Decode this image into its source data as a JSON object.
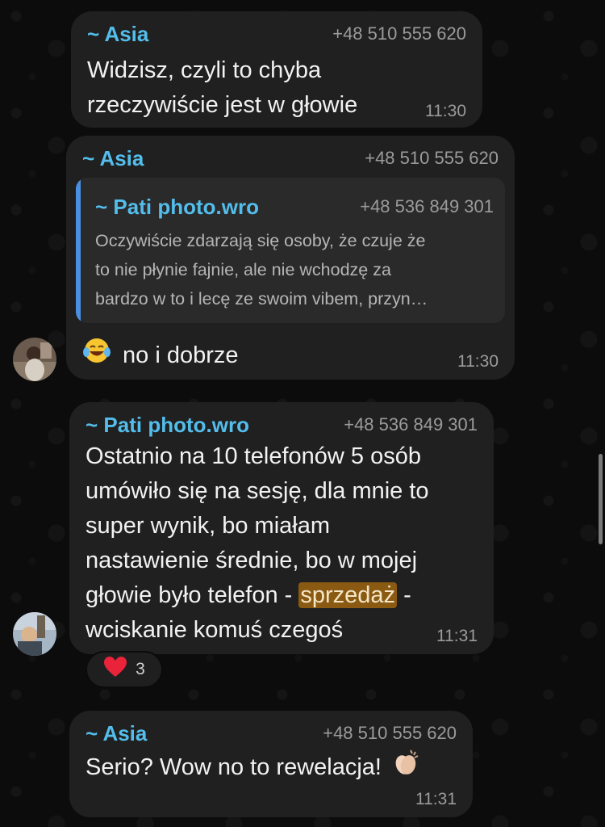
{
  "messages": [
    {
      "sender": "~ Asia",
      "phone": "+48 510 555 620",
      "lines": [
        "Widzisz, czyli to chyba",
        "rzeczywiście jest w głowie"
      ],
      "time": "11:30"
    },
    {
      "sender": "~ Asia",
      "phone": "+48 510 555 620",
      "quote": {
        "sender": "~ Pati photo.wro",
        "phone": "+48 536 849 301",
        "lines": [
          "Oczywiście zdarzają się osoby, że czuje że",
          "to nie płynie fajnie, ale nie wchodzę za",
          "bardzo w to i lecę ze swoim vibem, przyn…"
        ]
      },
      "emoji": "face-with-tears-of-joy",
      "text": "no i dobrze",
      "time": "11:30"
    },
    {
      "sender": "~ Pati photo.wro",
      "phone": "+48 536 849 301",
      "lines": [
        "Ostatnio na 10 telefonów 5 osób",
        "umówiło się na sesję, dla mnie to",
        "super wynik, bo miałam",
        "nastawienie średnie, bo w mojej",
        "wciskanie komuś czegoś"
      ],
      "line5_before": "głowie było telefon - ",
      "line5_highlight": "sprzedaż",
      "line5_after": " -",
      "time": "11:31",
      "reaction": {
        "emoji": "red-heart",
        "count": "3"
      }
    },
    {
      "sender": "~ Asia",
      "phone": "+48 510 555 620",
      "text": "Serio? Wow no to rewelacja!",
      "emoji": "clapping-hands",
      "time": "11:31"
    }
  ],
  "colors": {
    "background": "#0b0b0b",
    "bubble": "#202020",
    "sender": "#53bdeb",
    "quote_bar": "#4a90e2",
    "highlight": "#8a5a12"
  }
}
